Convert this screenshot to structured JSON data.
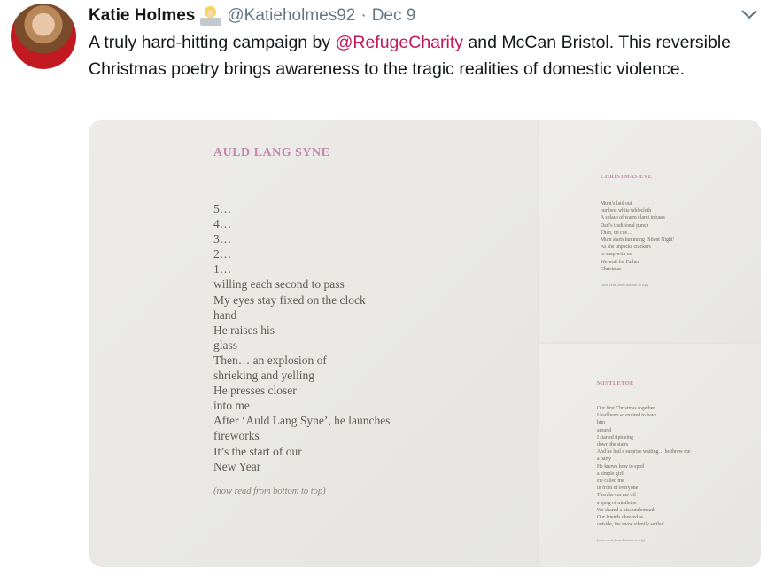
{
  "tweet": {
    "author_name": "Katie Holmes",
    "author_emoji": "woman-technologist-emoji",
    "handle": "@Katieholmes92",
    "separator": "·",
    "date": "Dec 9",
    "text_before": "A truly hard-hitting campaign by ",
    "mention": "@RefugeCharity",
    "text_after": " and McCan Bristol. This reversible Christmas poetry brings awareness to the tragic realities of domestic violence."
  },
  "media": {
    "main_poem": {
      "title": "AULD LANG SYNE",
      "lines": [
        "5…",
        "4…",
        "3…",
        "2…",
        "1…",
        "willing each second to pass",
        "My eyes stay fixed on the clock",
        "hand",
        "He raises his",
        "glass",
        "Then… an explosion of",
        "shrieking and yelling",
        "He presses closer",
        "into me",
        "After ‘Auld Lang Syne’, he launches",
        "fireworks",
        "It’s the start of our",
        "New Year"
      ],
      "footer": "(now read from bottom to top)"
    },
    "top_poem": {
      "title": "CHRISTMAS EVE",
      "lines": [
        "Mum’s laid out",
        "our best white tablecloth",
        "A splash of warm claret infuses",
        "Dad’s traditional punch",
        "Then, on cue…",
        "Mum starts humming ‘Silent Night’",
        "As she unpacks crackers",
        "to snap with us",
        "We wait for Father",
        "Christmas"
      ],
      "footer": "(now read from bottom to top)"
    },
    "bottom_poem": {
      "title": "MISTLETOE",
      "lines": [
        "Our first Christmas together",
        "I had been so excited to have",
        "him",
        "around",
        "I started tiptoeing",
        "down the stairs",
        "And he had a surprise waiting… he threw me",
        "a party",
        "He knows how to spoil",
        "a simple girl!",
        "He called me",
        "in front of everyone",
        "Then he cut me off",
        "a sprig of mistletoe",
        "We shared a kiss underneath",
        "Our friends cheered as",
        "outside, the snow silently settled"
      ],
      "footer": "(now read from bottom to top)"
    }
  },
  "colors": {
    "mention": "#c2185b",
    "poem_title": "#c489a8",
    "handle_grey": "#657786",
    "paper": "#ebeae6"
  }
}
